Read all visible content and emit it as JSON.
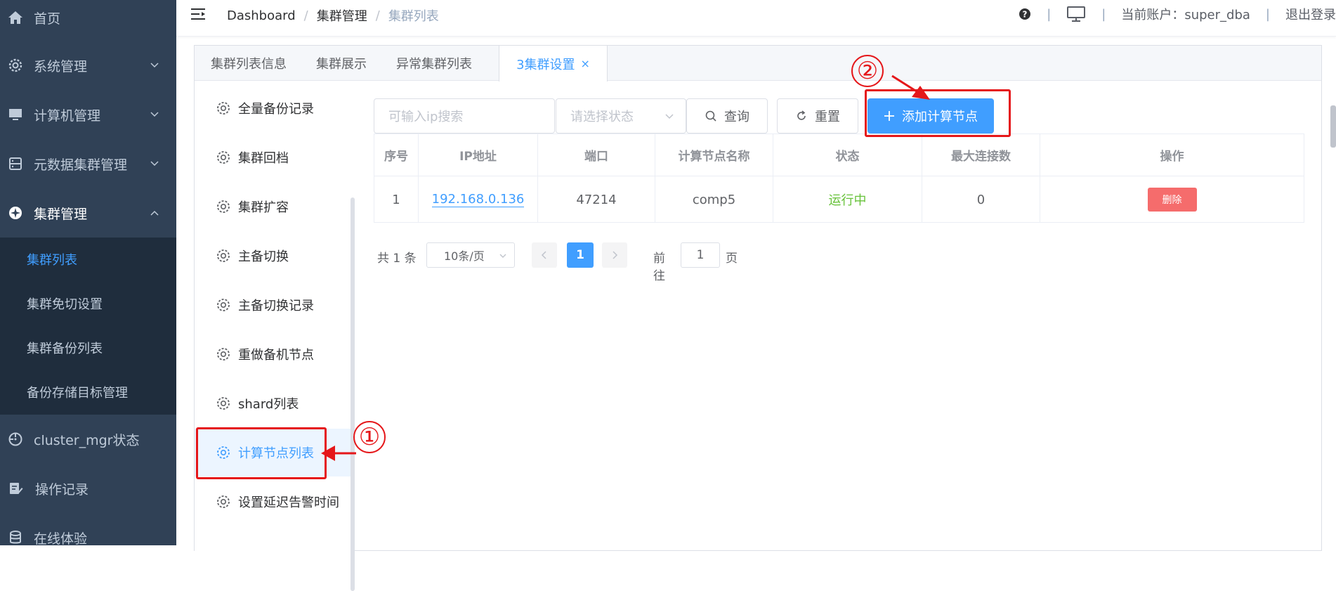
{
  "sidebar": {
    "items": [
      {
        "label": "首页"
      },
      {
        "label": "系统管理"
      },
      {
        "label": "计算机管理"
      },
      {
        "label": "元数据集群管理"
      },
      {
        "label": "集群管理"
      },
      {
        "label": "cluster_mgr状态"
      },
      {
        "label": "操作记录"
      },
      {
        "label": "在线体验"
      }
    ],
    "submenu": [
      {
        "label": "集群列表"
      },
      {
        "label": "集群免切设置"
      },
      {
        "label": "集群备份列表"
      },
      {
        "label": "备份存储目标管理"
      }
    ]
  },
  "navbar": {
    "breadcrumb": [
      "Dashboard",
      "集群管理",
      "集群列表"
    ],
    "separator": "/",
    "account_label": "当前账户：super_dba",
    "logout_label": "退出登录",
    "divider": "|"
  },
  "tabs": [
    {
      "label": "集群列表信息"
    },
    {
      "label": "集群展示"
    },
    {
      "label": "异常集群列表"
    },
    {
      "label": "3集群设置",
      "close": "×"
    }
  ],
  "inner_menu": [
    {
      "label": "全量备份记录"
    },
    {
      "label": "集群回档"
    },
    {
      "label": "集群扩容"
    },
    {
      "label": "主备切换"
    },
    {
      "label": "主备切换记录"
    },
    {
      "label": "重做备机节点"
    },
    {
      "label": "shard列表"
    },
    {
      "label": "计算节点列表"
    },
    {
      "label": "设置延迟告警时间"
    }
  ],
  "toolbar": {
    "search_placeholder": "可输入ip搜索",
    "status_placeholder": "请选择状态",
    "query_label": "查询",
    "reset_label": "重置",
    "add_label": "添加计算节点"
  },
  "table": {
    "columns": [
      "序号",
      "IP地址",
      "端口",
      "计算节点名称",
      "状态",
      "最大连接数",
      "操作"
    ],
    "rows": [
      {
        "index": "1",
        "ip": "192.168.0.136",
        "port": "47214",
        "name": "comp5",
        "status": "运行中",
        "max_conn": "0",
        "action": "删除"
      }
    ]
  },
  "pagination": {
    "total": "共 1 条",
    "page_size": "10条/页",
    "current_page": "1",
    "goto_label": "前往",
    "goto_value": "1",
    "page_suffix": "页"
  },
  "annotations": {
    "step1": "①",
    "step2": "②"
  },
  "colors": {
    "sidebar_bg": "#304156",
    "submenu_bg": "#1f2d3d",
    "primary": "#409eff",
    "danger": "#f56c6c",
    "success": "#67c23a",
    "annotation_red": "#e5171a"
  }
}
